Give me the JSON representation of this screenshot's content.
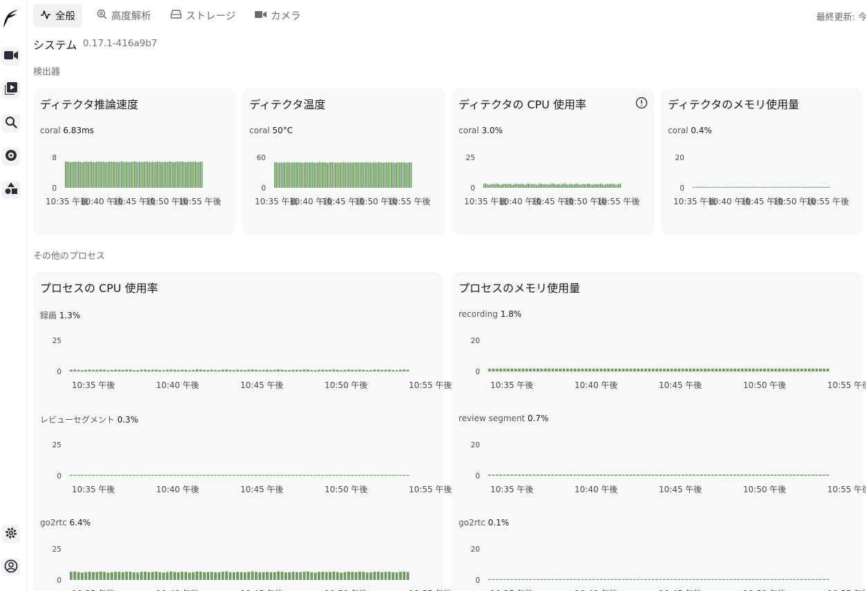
{
  "colors": {
    "bar": "#6b9c5e",
    "bar_dark": "#5a8a4e",
    "accent_bg": "#f1f2f4"
  },
  "nav": {
    "tabs": [
      {
        "label": "全般",
        "icon": "activity-icon",
        "active": true
      },
      {
        "label": "高度解析",
        "icon": "search-zoom-icon",
        "active": false
      },
      {
        "label": "ストレージ",
        "icon": "hard-drive-icon",
        "active": false
      },
      {
        "label": "カメラ",
        "icon": "video-camera-icon",
        "active": false
      }
    ],
    "updated": "最終更新: 今"
  },
  "sidebar": {
    "items": [
      {
        "name": "live-view",
        "icon": "video-camera-icon"
      },
      {
        "name": "review",
        "icon": "play-library-icon"
      },
      {
        "name": "explore",
        "icon": "search-icon"
      },
      {
        "name": "export",
        "icon": "disc-icon"
      },
      {
        "name": "classification",
        "icon": "shapes-icon"
      },
      {
        "name": "settings",
        "icon": "gear-icon"
      },
      {
        "name": "account",
        "icon": "user-circle-icon"
      }
    ]
  },
  "system": {
    "title": "システム",
    "version": "0.17.1-416a9b7"
  },
  "sections": {
    "detectors": "検出器",
    "other_processes": "その他のプロセス"
  },
  "x_ticks": [
    "10:35 午後",
    "10:40 午後",
    "10:45 午後",
    "10:50 午後",
    "10:55 午後"
  ],
  "detector_cards": [
    {
      "title": "ディテクタ推論速度",
      "label": "coral",
      "value": "6.83ms",
      "info": false,
      "chart_data": {
        "type": "bar",
        "ylim": [
          0,
          8
        ],
        "yticks": [
          "8",
          "0"
        ],
        "series": [
          {
            "name": "coral",
            "base": 6.83,
            "jitter": 0.12
          }
        ]
      }
    },
    {
      "title": "ディテクタ温度",
      "label": "coral",
      "value": "50°C",
      "info": false,
      "chart_data": {
        "type": "bar",
        "ylim": [
          0,
          60
        ],
        "yticks": [
          "60",
          "0"
        ],
        "series": [
          {
            "name": "coral",
            "base": 50,
            "jitter": 0.6
          }
        ]
      }
    },
    {
      "title": "ディテクタの CPU 使用率",
      "label": "coral",
      "value": "3.0%",
      "info": true,
      "chart_data": {
        "type": "bar",
        "ylim": [
          0,
          25
        ],
        "yticks": [
          "25",
          "0"
        ],
        "series": [
          {
            "name": "coral",
            "base": 3.0,
            "jitter": 0.6
          }
        ]
      }
    },
    {
      "title": "ディテクタのメモリ使用量",
      "label": "coral",
      "value": "0.4%",
      "info": false,
      "chart_data": {
        "type": "bar",
        "ylim": [
          0,
          20
        ],
        "yticks": [
          "20",
          "0"
        ],
        "series": [
          {
            "name": "coral",
            "base": 0.4,
            "jitter": 0.0
          }
        ]
      }
    }
  ],
  "process_cards": [
    {
      "title": "プロセスの CPU 使用率",
      "charts": [
        {
          "label": "録画",
          "value": "1.3%",
          "chart_data": {
            "type": "bar",
            "ylim": [
              0,
              25
            ],
            "yticks": [
              "25",
              "0"
            ],
            "series": [
              {
                "name": "録画",
                "base": 1.3,
                "jitter": 0.3
              }
            ]
          }
        },
        {
          "label": "レビューセグメント",
          "value": "0.3%",
          "chart_data": {
            "type": "bar",
            "ylim": [
              0,
              25
            ],
            "yticks": [
              "25",
              "0"
            ],
            "series": [
              {
                "name": "レビューセグメント",
                "base": 0.3,
                "jitter": 0.0
              }
            ]
          }
        },
        {
          "label": "go2rtc",
          "value": "6.4%",
          "chart_data": {
            "type": "bar",
            "ylim": [
              0,
              25
            ],
            "yticks": [
              "25",
              "0"
            ],
            "series": [
              {
                "name": "go2rtc",
                "base": 6.4,
                "jitter": 0.5
              }
            ]
          }
        }
      ]
    },
    {
      "title": "プロセスのメモリ使用量",
      "charts": [
        {
          "label": "recording",
          "value": "1.8%",
          "chart_data": {
            "type": "bar",
            "ylim": [
              0,
              20
            ],
            "yticks": [
              "20",
              "0"
            ],
            "series": [
              {
                "name": "recording",
                "base": 1.8,
                "jitter": 0.0
              }
            ]
          }
        },
        {
          "label": "review segment",
          "value": "0.7%",
          "chart_data": {
            "type": "bar",
            "ylim": [
              0,
              20
            ],
            "yticks": [
              "20",
              "0"
            ],
            "series": [
              {
                "name": "review segment",
                "base": 0.7,
                "jitter": 0.0
              }
            ]
          }
        },
        {
          "label": "go2rtc",
          "value": "0.1%",
          "chart_data": {
            "type": "bar",
            "ylim": [
              0,
              20
            ],
            "yticks": [
              "20",
              "0"
            ],
            "series": [
              {
                "name": "go2rtc",
                "base": 0.1,
                "jitter": 0.0
              }
            ]
          }
        }
      ]
    }
  ]
}
